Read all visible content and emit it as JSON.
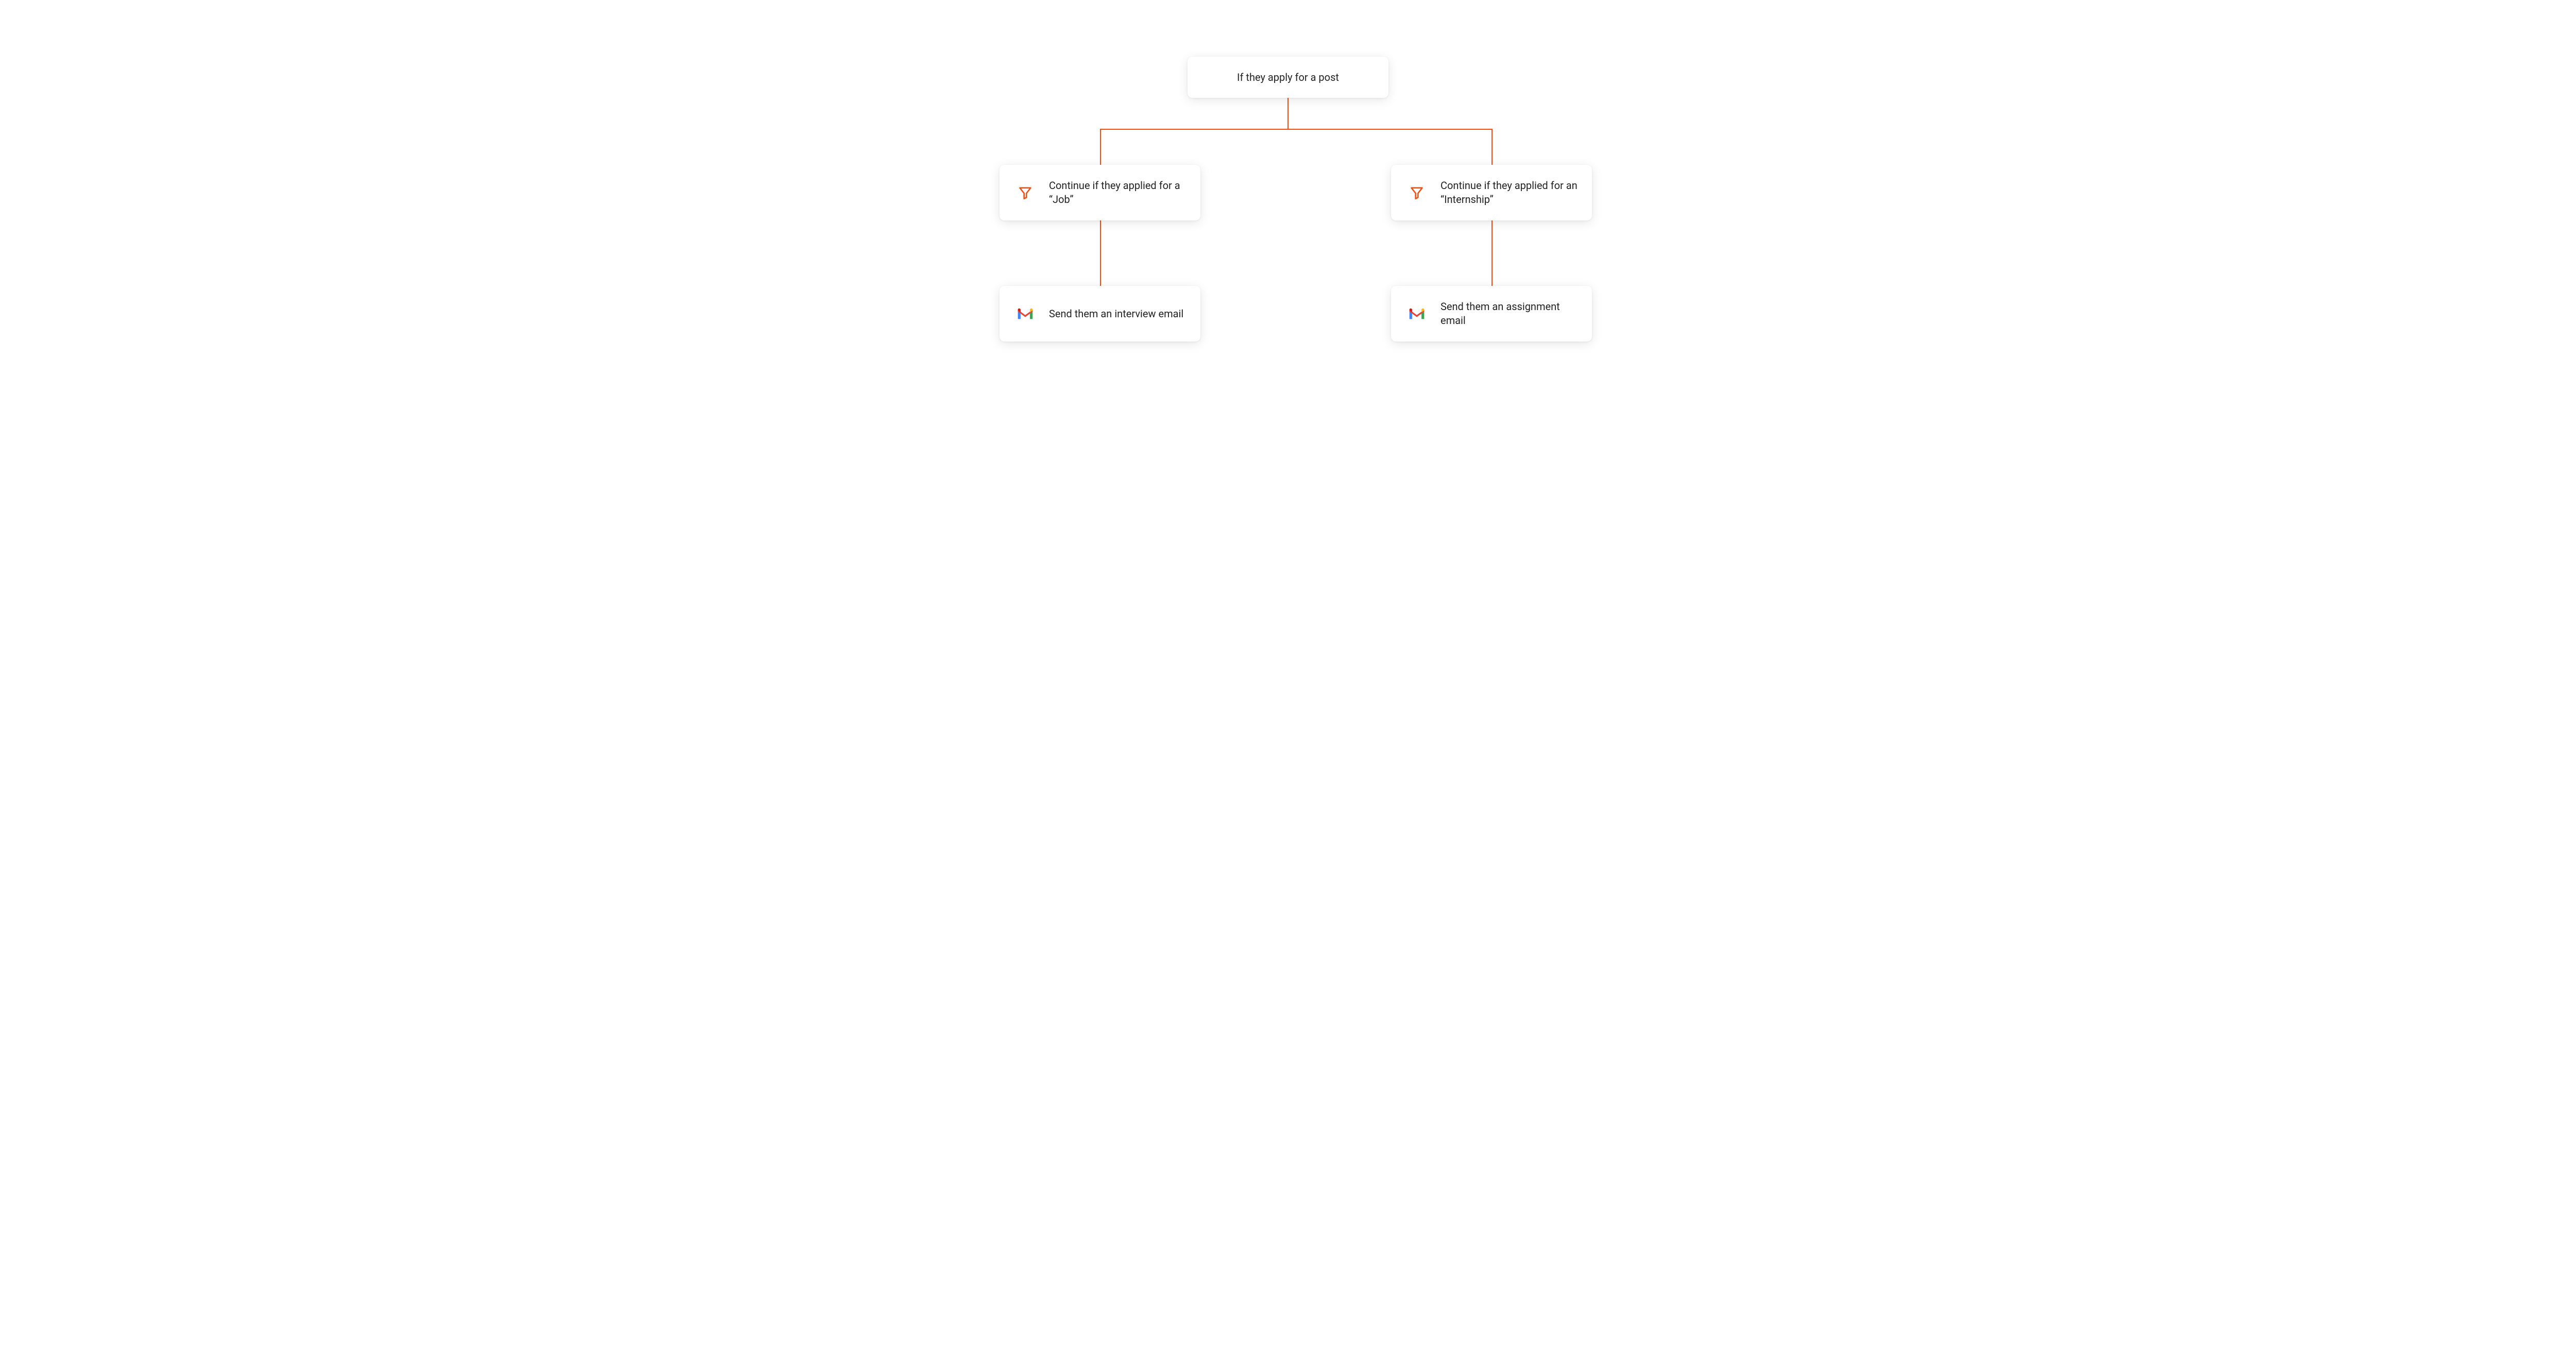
{
  "flow": {
    "root": {
      "label": "If they apply for a post"
    },
    "branches": [
      {
        "filter": {
          "icon": "filter-icon",
          "label": "Continue if they applied for a “Job”"
        },
        "action": {
          "icon": "gmail-icon",
          "label": "Send them an interview email"
        }
      },
      {
        "filter": {
          "icon": "filter-icon",
          "label": "Continue if they applied for an “Internship”"
        },
        "action": {
          "icon": "gmail-icon",
          "label": "Send them an assignment email"
        }
      }
    ]
  },
  "colors": {
    "connector": "#f24f13",
    "node_bg": "#ffffff",
    "text": "#222222"
  }
}
